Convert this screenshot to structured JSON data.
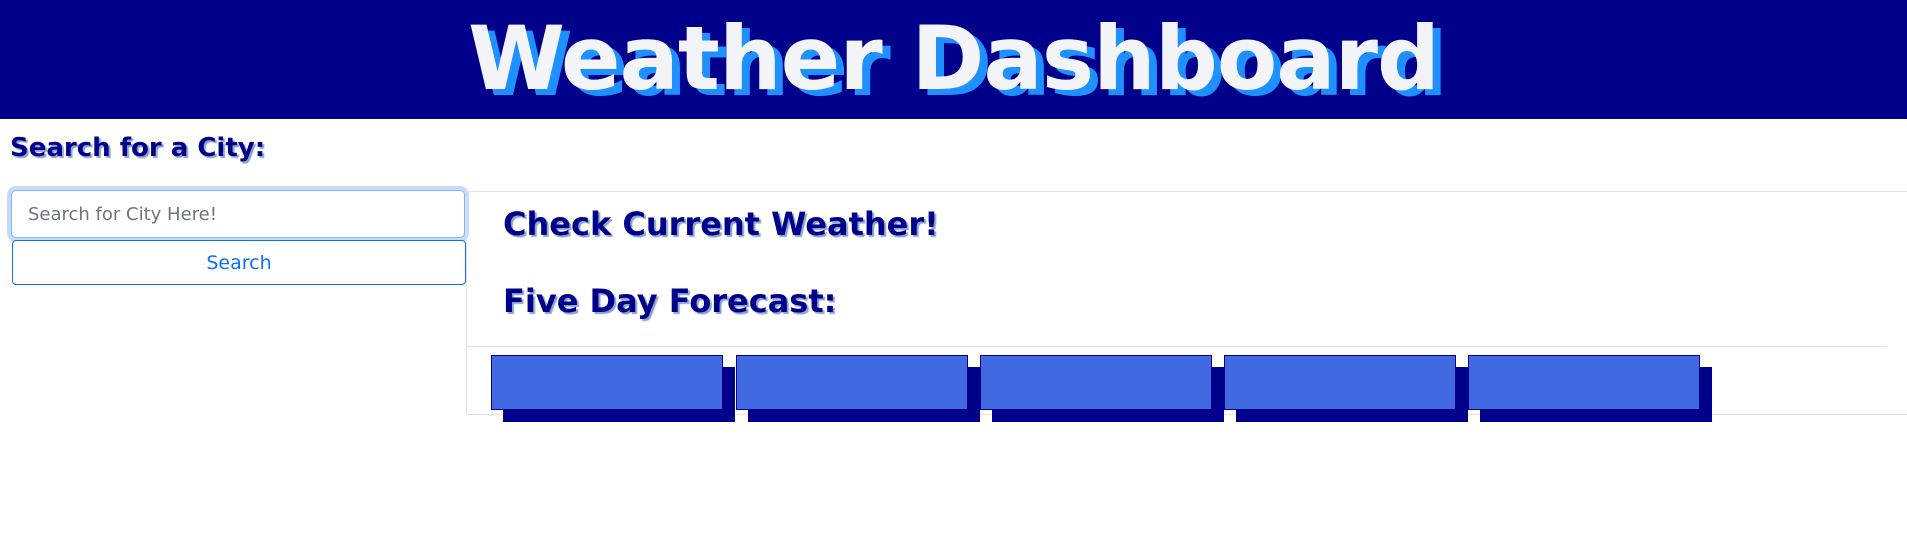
{
  "header": {
    "title": "Weather Dashboard"
  },
  "search": {
    "label": "Search for a City:",
    "placeholder": "Search for City Here!",
    "value": "",
    "button_label": "Search"
  },
  "current_weather": {
    "title": "Check Current Weather!"
  },
  "forecast": {
    "title": "Five Day Forecast:",
    "cards": [
      {},
      {},
      {},
      {},
      {}
    ]
  },
  "colors": {
    "header_bg": "#00008b",
    "title_text": "#f2f4f8",
    "title_shadow": "#1e90ff",
    "accent_text": "#00008b",
    "card_fill": "#4169e1",
    "card_shadow": "#00008b",
    "button_blue": "#0d6efd"
  }
}
